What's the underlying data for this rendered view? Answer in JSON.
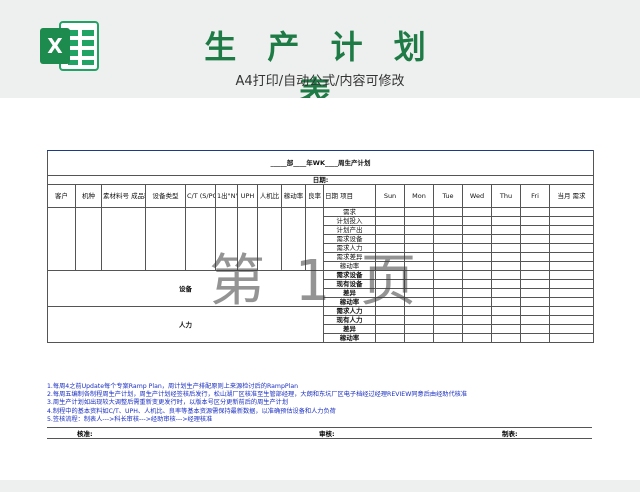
{
  "header": {
    "title": "生 产 计 划 表",
    "subtitle": "A4打印/自动公式/内容可修改",
    "logo_letter": "X"
  },
  "doc": {
    "title": "_____部____年WK____周生产计划",
    "date_label": "日期:",
    "columns": {
      "customer": "客户",
      "model": "机种",
      "material": "素材料号 成品料号",
      "equipment_type": "设备类型",
      "ct": "C/T (S/PCS)",
      "one_out": "1出\"N\"",
      "uph": "UPH",
      "man_machine": "人机比",
      "utilization": "稼动率",
      "yield": "良率",
      "date_item": "日期 项目",
      "days": [
        "Sun",
        "Mon",
        "Tue",
        "Wed",
        "Thu",
        "Fri"
      ],
      "month_demand": "当月 需求"
    },
    "items": [
      "需求",
      "计划投入",
      "计划产出",
      "需求设备",
      "需求人力",
      "需求差异",
      "稼动率"
    ],
    "equipment_rows": [
      "需求设备",
      "现有设备",
      "差异",
      "稼动率"
    ],
    "manpower_rows": [
      "需求人力",
      "现有人力",
      "差异",
      "稼动率"
    ],
    "equipment_label": "设备",
    "manpower_label": "人力",
    "notes": [
      "1.每周4之前Update每个专案Ramp Plan，周计划生产排配原则上来源检讨后的RampPlan",
      "2.每周五编制各制程周生产计划，周生产计划经签核后发行，松山湖厂区核准至生管部经理，大朗和东坑厂区电子档经过经理REVIEW同意后由经助代核准",
      "3.周生产计划如出现较大调整后需重新变更发行时，以版本号区分更新前后的周生产计划",
      "4.制程中的基本资料如C/T、UPH、人机比、良率等基本资源需保持最新数据，以准确预估设备和人力负荷",
      "5.签核流程：制表人--->科长审核--->经助审核--->经理核准"
    ],
    "signatures": {
      "approve": "核准:",
      "review": "审核:",
      "prepare": "制表:"
    },
    "watermark": "第 1 页"
  },
  "colors": {
    "title_green": "#1e7b45",
    "excel_green": "#21a366",
    "notes_blue": "#1a2fc0",
    "frame_blue": "#1c3a8a"
  }
}
